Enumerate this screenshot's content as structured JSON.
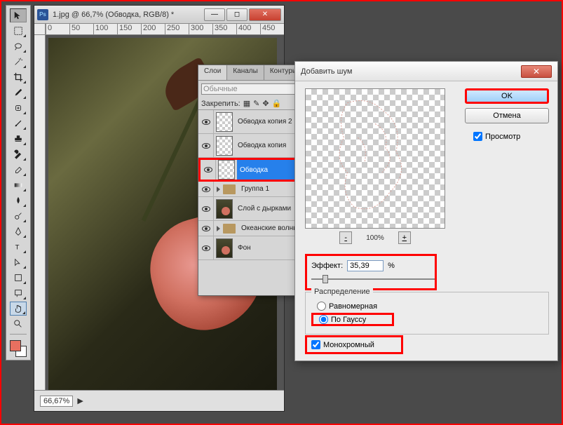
{
  "document": {
    "title": "1.jpg @ 66,7% (Обводка, RGB/8) *",
    "zoom_status": "66,67%",
    "ruler_marks": [
      "0",
      "50",
      "100",
      "150",
      "200",
      "250",
      "300",
      "350",
      "400",
      "450"
    ]
  },
  "toolbar": {
    "tools": [
      "move-tool",
      "marquee-tool",
      "lasso-tool",
      "wand-tool",
      "crop-tool",
      "eyedropper-tool",
      "healing-tool",
      "brush-tool",
      "stamp-tool",
      "history-brush-tool",
      "eraser-tool",
      "gradient-tool",
      "blur-tool",
      "dodge-tool",
      "pen-tool",
      "type-tool",
      "path-select-tool",
      "shape-tool",
      "hand-tool",
      "zoom-tool"
    ],
    "fg_color": "#e87060",
    "bg_color": "#ffffff"
  },
  "layers_panel": {
    "tabs": {
      "layers": "Слои",
      "channels": "Каналы",
      "paths": "Контуры"
    },
    "blend_mode": "Обычные",
    "lock_label": "Закрепить:",
    "layers": [
      {
        "name": "Обводка копия 2",
        "visible": true,
        "thumb": "checker"
      },
      {
        "name": "Обводка копия",
        "visible": true,
        "thumb": "checker"
      },
      {
        "name": "Обводка",
        "visible": true,
        "selected": true,
        "thumb": "checker"
      },
      {
        "name": "Группа 1",
        "visible": true,
        "group": true
      },
      {
        "name": "Слой с дырками",
        "visible": true,
        "thumb": "img"
      },
      {
        "name": "Океанские волны",
        "visible": true,
        "group": true
      },
      {
        "name": "Фон",
        "visible": true,
        "thumb": "img"
      }
    ]
  },
  "dialog": {
    "title": "Добавить шум",
    "ok_label": "OK",
    "cancel_label": "Отмена",
    "preview_label": "Просмотр",
    "preview_checked": true,
    "zoom_value": "100%",
    "effect_label": "Эффект:",
    "effect_value": "35,39",
    "effect_unit": "%",
    "distribution": {
      "legend": "Распределение",
      "uniform": "Равномерная",
      "gaussian": "По Гауссу",
      "selected": "gaussian"
    },
    "mono_label": "Монохромный",
    "mono_checked": true
  }
}
